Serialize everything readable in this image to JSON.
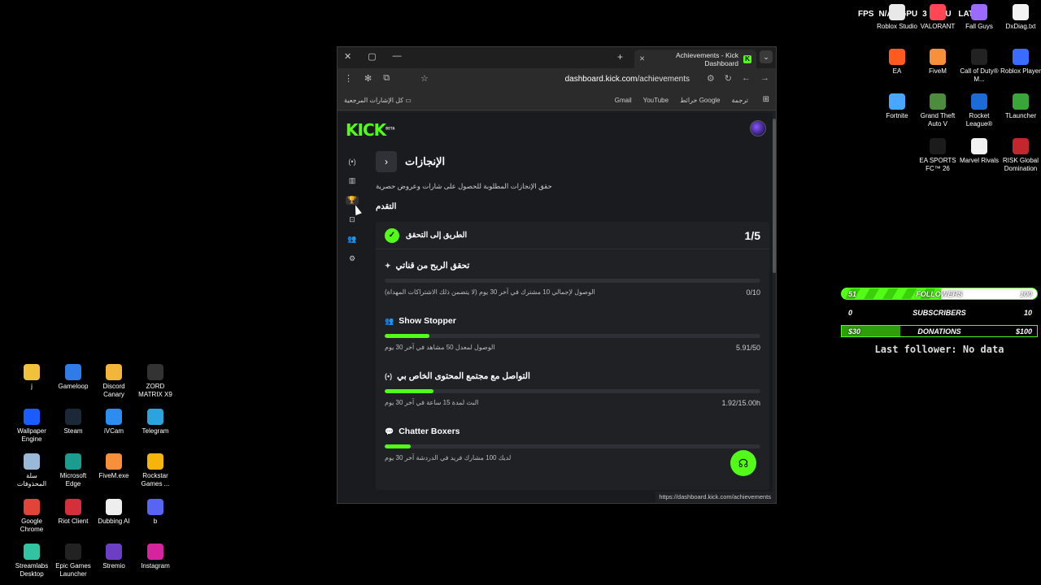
{
  "overlay": {
    "fps_label": "FPS",
    "fps_value": "N/A",
    "gpu_label": "GPU",
    "gpu_value": "3",
    "cpu_label": "CPU",
    "lat_label": "LAT",
    "lat_value": "A"
  },
  "desktop_icons_right": [
    {
      "label": "Roblox Studio",
      "icon": "roblox-studio-icon",
      "color": "#e8e8e8"
    },
    {
      "label": "VALORANT",
      "icon": "valorant-icon",
      "color": "#ff4655"
    },
    {
      "label": "Fall Guys",
      "icon": "fall-guys-icon",
      "color": "#9b6bff"
    },
    {
      "label": "DxDiag.txt",
      "icon": "text-file-icon",
      "color": "#f2f2f2"
    },
    {
      "label": "EA",
      "icon": "ea-icon",
      "color": "#ff5a1f"
    },
    {
      "label": "FiveM",
      "icon": "fivem-icon",
      "color": "#f78f3b"
    },
    {
      "label": "Call of Duty® M...",
      "icon": "call-of-duty-icon",
      "color": "#222222"
    },
    {
      "label": "Roblox Player",
      "icon": "roblox-player-icon",
      "color": "#3a6cff"
    },
    {
      "label": "Fortnite",
      "icon": "fortnite-icon",
      "color": "#4aa7ff"
    },
    {
      "label": "Grand Theft Auto V",
      "icon": "gta-icon",
      "color": "#4c8c3c"
    },
    {
      "label": "Rocket League®",
      "icon": "rocket-league-icon",
      "color": "#1d6bd6"
    },
    {
      "label": "TLauncher",
      "icon": "tlauncher-icon",
      "color": "#3aa53a"
    },
    {
      "label": "EA SPORTS FC™ 26",
      "icon": "ea-fc-icon",
      "color": "#1b1b1b"
    },
    {
      "label": "Marvel Rivals",
      "icon": "marvel-rivals-file-icon",
      "color": "#f2f2f2"
    },
    {
      "label": "RISK Global Domination",
      "icon": "risk-icon",
      "color": "#c4262e"
    }
  ],
  "desktop_icons_left": [
    {
      "label": "j",
      "icon": "folder-icon",
      "color": "#f0c23b"
    },
    {
      "label": "Gameloop",
      "icon": "gameloop-icon",
      "color": "#2f7be8"
    },
    {
      "label": "Discord Canary",
      "icon": "discord-canary-icon",
      "color": "#f3b53a"
    },
    {
      "label": "ZORD MATRIX X9",
      "icon": "zord-icon",
      "color": "#333333"
    },
    {
      "label": "Wallpaper Engine",
      "icon": "wallpaper-engine-icon",
      "color": "#1b5cff"
    },
    {
      "label": "Steam",
      "icon": "steam-icon",
      "color": "#1b2838"
    },
    {
      "label": "iVCam",
      "icon": "ivcam-icon",
      "color": "#2d8cf0"
    },
    {
      "label": "Telegram",
      "icon": "telegram-icon",
      "color": "#2aa3df"
    },
    {
      "label": "سلة المحذوفات",
      "icon": "recycle-bin-icon",
      "color": "#9ab8d8"
    },
    {
      "label": "Microsoft Edge",
      "icon": "edge-icon",
      "color": "#1a9d8f"
    },
    {
      "label": "FiveM.exe",
      "icon": "fivem-exe-icon",
      "color": "#f78f3b"
    },
    {
      "label": "Rockstar Games ...",
      "icon": "rockstar-icon",
      "color": "#f5b50a"
    },
    {
      "label": "Google Chrome",
      "icon": "chrome-icon",
      "color": "#e2443a"
    },
    {
      "label": "Riot Client",
      "icon": "riot-client-icon",
      "color": "#d3303a"
    },
    {
      "label": "Dubbing AI",
      "icon": "dubbing-ai-icon",
      "color": "#eeeeee"
    },
    {
      "label": "b",
      "icon": "discord-icon",
      "color": "#5865f2"
    },
    {
      "label": "Streamlabs Desktop",
      "icon": "streamlabs-icon",
      "color": "#31c3a2"
    },
    {
      "label": "Epic Games Launcher",
      "icon": "epic-games-icon",
      "color": "#222222"
    },
    {
      "label": "Stremio",
      "icon": "stremio-icon",
      "color": "#6b3fc4"
    },
    {
      "label": "Instagram",
      "icon": "instagram-icon",
      "color": "#d6249f"
    }
  ],
  "widget": {
    "followers": {
      "current": "51",
      "label": "FOLLOWERS",
      "goal": "100",
      "progress": 0.51
    },
    "subscribers": {
      "current": "0",
      "label": "SUBSCRIBERS",
      "goal": "10"
    },
    "donations": {
      "current": "$30",
      "label": "DONATIONS",
      "goal": "$100",
      "progress": 0.3
    },
    "last_follower": "Last follower: No data"
  },
  "browser": {
    "tab_title": "Achievements - Kick Dashboard",
    "url_host": "dashboard.kick.com",
    "url_path": "/achievements",
    "all_bookmarks": "كل الإشارات المرجعية",
    "bookmarks": [
      "ترجمة",
      "خرائط Google",
      "YouTube",
      "Gmail"
    ],
    "status_url": "https://dashboard.kick.com/achievements"
  },
  "page": {
    "logo": "KICK",
    "logo_tag": "BETA",
    "title": "الإنجازات",
    "subtitle": "حقق الإنجازات المطلوبة للحصول على شارات وعروض حصرية",
    "section": "التقدم",
    "card_title": "الطريق إلى التحقق",
    "card_count": "1/5",
    "achievements": [
      {
        "name": "تحقق الربح من قناتي",
        "icon": "sparkle-icon",
        "desc": "الوصول لإجمالي 10 مشترك في آخر 30 يوم (لا يتضمن ذلك الاشتراكات المهداة)",
        "progress_text": "0/10",
        "progress": 0.0
      },
      {
        "name": "Show Stopper",
        "icon": "users-icon",
        "desc": "الوصول لمعدل 50 مشاهد في آخر 30 يوم",
        "progress_text": "5.91/50",
        "progress": 0.12
      },
      {
        "name": "التواصل مع مجتمع المحتوى الخاص بي",
        "icon": "broadcast-icon",
        "desc": "البث لمدة 15 ساعة في آخر 30 يوم",
        "progress_text": "1.92/15.00h",
        "progress": 0.13
      },
      {
        "name": "Chatter Boxers",
        "icon": "chat-icon",
        "desc": "لديك 100 مشارك فريد في الدردشة آخر 30 يوم",
        "progress_text": "",
        "progress": 0.07
      }
    ]
  }
}
